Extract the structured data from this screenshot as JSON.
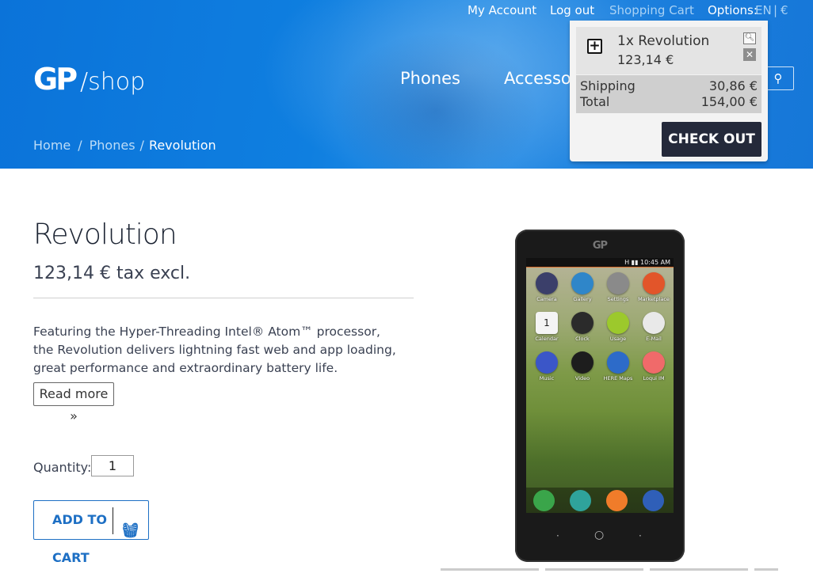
{
  "topnav": {
    "my_account": "My Account",
    "log_out": "Log out",
    "shopping_cart": "Shopping Cart",
    "options_label": "Options:",
    "options_lang": "EN",
    "options_sep": "|",
    "options_currency": "€"
  },
  "logo": {
    "mark": "GP",
    "text": "shop"
  },
  "mainnav": {
    "phones": "Phones",
    "accessories": "Accessor"
  },
  "breadcrumb": {
    "home": "Home",
    "sep1": "/",
    "phones": "Phones",
    "sep2": "/",
    "current": "Revolution"
  },
  "cart": {
    "item_name": "1x Revolution",
    "item_price": "123,14 €",
    "shipping_label": "Shipping",
    "shipping_value": "30,86 €",
    "total_label": "Total",
    "total_value": "154,00 €",
    "checkout_label": "CHECK OUT"
  },
  "product": {
    "title": "Revolution",
    "price": "123,14 € tax excl.",
    "description": "Featuring the Hyper-Threading Intel® Atom™ processor, the Revolution delivers lightning fast web and app loading, great performance and extraordinary battery life.",
    "read_more": "Read more »",
    "quantity_label": "Quantity:",
    "quantity_value": "1",
    "add_to_cart": "ADD TO CART"
  },
  "phone": {
    "logo": "GP",
    "status": "H ▮▮ 10:45 AM",
    "apps": [
      "Camera",
      "Gallery",
      "Settings",
      "Marketplace",
      "Calendar",
      "Clock",
      "Usage",
      "E-Mail",
      "Music",
      "Video",
      "HERE Maps",
      "Loqui IM"
    ],
    "app_colors": [
      "#3b3f6a",
      "#2f86c9",
      "#8a8a8a",
      "#e2552a",
      "#f4f4f4",
      "#2b2b2b",
      "#9cc92c",
      "#e9e9e9",
      "#3b56c8",
      "#1d1d1d",
      "#2d6bc9",
      "#f06a6a"
    ],
    "calendar_day": "1",
    "dock_colors": [
      "#3aa54a",
      "#2fa39b",
      "#f07c2a",
      "#2f5fb8"
    ]
  }
}
